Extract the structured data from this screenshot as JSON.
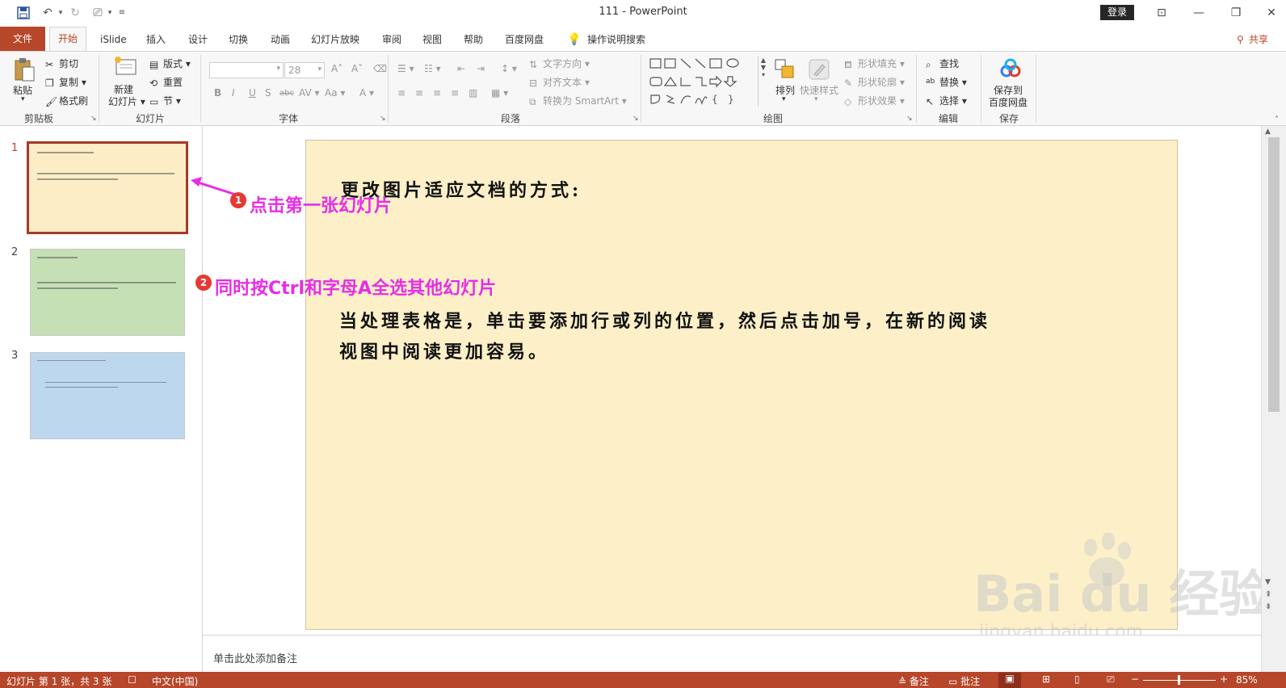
{
  "app": {
    "title": "111  -  PowerPoint",
    "login_label": "登录"
  },
  "tabs": [
    {
      "label": "文件"
    },
    {
      "label": "开始"
    },
    {
      "label": "iSlide"
    },
    {
      "label": "插入"
    },
    {
      "label": "设计"
    },
    {
      "label": "切换"
    },
    {
      "label": "动画"
    },
    {
      "label": "幻灯片放映"
    },
    {
      "label": "审阅"
    },
    {
      "label": "视图"
    },
    {
      "label": "帮助"
    },
    {
      "label": "百度网盘"
    },
    {
      "label": "操作说明搜索"
    }
  ],
  "share_label": "共享",
  "ribbon": {
    "clipboard": {
      "paste": "粘贴",
      "cut": "剪切",
      "copy": "复制",
      "format_painter": "格式刷",
      "group": "剪贴板"
    },
    "slides": {
      "new_slide_1": "新建",
      "new_slide_2": "幻灯片",
      "layout": "版式",
      "reset": "重置",
      "section": "节",
      "group": "幻灯片"
    },
    "font": {
      "size": "28",
      "group": "字体"
    },
    "paragraph": {
      "text_direction": "文字方向",
      "align_text": "对齐文本",
      "smartart": "转换为 SmartArt",
      "group": "段落"
    },
    "drawing": {
      "arrange": "排列",
      "quick_styles": "快速样式",
      "shape_fill": "形状填充",
      "shape_outline": "形状轮廓",
      "shape_effects": "形状效果",
      "group": "绘图"
    },
    "editing": {
      "find": "查找",
      "replace": "替换",
      "select": "选择",
      "group": "编辑"
    },
    "save": {
      "save_to_1": "保存到",
      "save_to_2": "百度网盘",
      "group": "保存"
    }
  },
  "slides": [
    {
      "number": "1",
      "color": "#fcedc6",
      "selected": true
    },
    {
      "number": "2",
      "color": "#c5e0b4",
      "selected": false
    },
    {
      "number": "3",
      "color": "#bdd7ee",
      "selected": false
    }
  ],
  "main_slide": {
    "title": "更改图片适应文档的方式:",
    "body_line1": "当处理表格是，单击要添加行或列的位置，然后点击加号，在新的阅读",
    "body_line2": "视图中阅读更加容易。"
  },
  "annotations": {
    "step1_number": "1",
    "step1_text": "点击第一张幻灯片",
    "step2_number": "2",
    "step2_text": "同时按Ctrl和字母A全选其他幻灯片"
  },
  "notes_placeholder": "单击此处添加备注",
  "status": {
    "slide_info": "幻灯片 第 1 张，共 3 张",
    "language": "中文(中国)",
    "notes": "备注",
    "comments": "批注",
    "zoom": "85%"
  },
  "watermark": {
    "main": "Bai du 经验",
    "sub": "jingyan.baidu.com"
  },
  "colors": {
    "accent": "#b7472a",
    "annotation": "#e62ee6",
    "badge": "#e53935"
  }
}
